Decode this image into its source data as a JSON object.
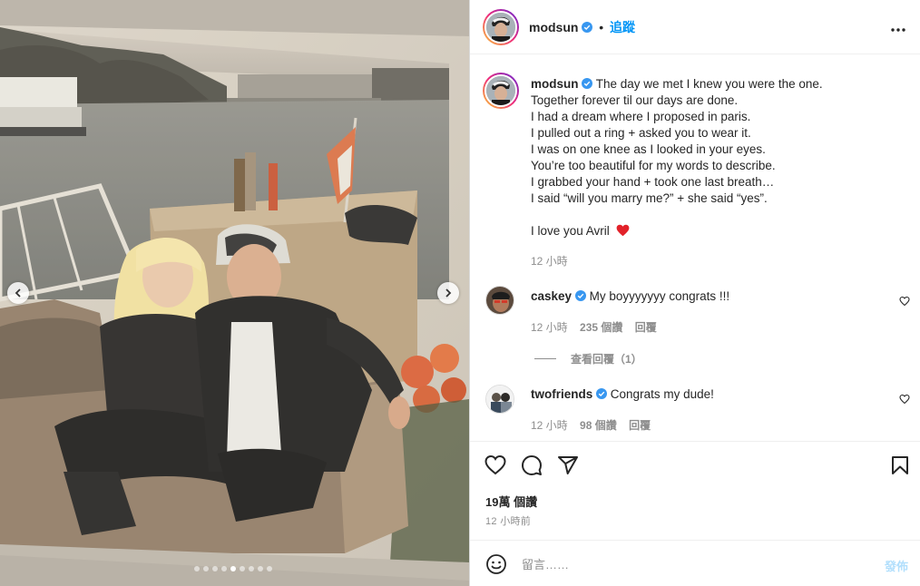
{
  "post": {
    "author": "modsun",
    "follow_label": "追蹤",
    "separator": "•",
    "more_label": "•••"
  },
  "caption": {
    "username": "modsun",
    "lines": [
      "The day we met I knew you were the one.",
      "Together forever til our days are done.",
      "I had a dream where I proposed in paris.",
      "I pulled out a ring + asked you to wear it.",
      "I was on one knee as I looked in your eyes.",
      "You’re too beautiful for my words to describe.",
      "I grabbed your hand + took one last breath…",
      "I said “will you marry me?” + she said “yes”.",
      "I love you Avril"
    ],
    "time": "12 小時"
  },
  "comments": [
    {
      "username": "caskey",
      "text": "My boyyyyyyy congrats !!!",
      "time": "12 小時",
      "likes": "235 個讚",
      "reply": "回覆",
      "view_replies": "查看回覆（1）"
    },
    {
      "username": "twofriends",
      "text": "Congrats my dude!",
      "time": "12 小時",
      "likes": "98 個讚",
      "reply": "回覆"
    }
  ],
  "actions": {
    "likes": "19萬 個讚",
    "time": "12 小時前"
  },
  "composer": {
    "placeholder": "留言……",
    "post_label": "發佈"
  },
  "carousel": {
    "slide_count": 9,
    "active_index": 4
  },
  "colors": {
    "accent": "#0095f6",
    "heart": "#ed4956",
    "muted": "#8e8e8e"
  }
}
